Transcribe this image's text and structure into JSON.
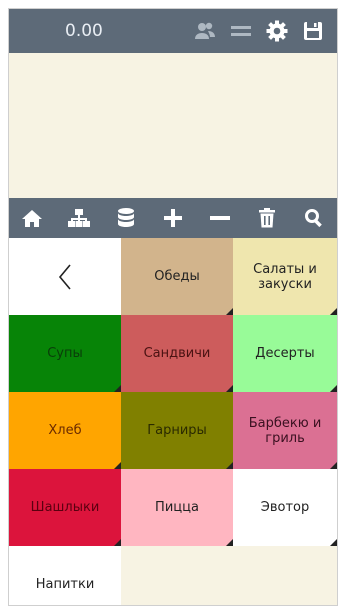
{
  "header": {
    "amount": "0.00",
    "icons": [
      "users-icon",
      "menu-lines-icon",
      "gear-icon",
      "save-icon"
    ]
  },
  "toolbar": {
    "buttons": [
      "home-icon",
      "hierarchy-icon",
      "database-icon",
      "plus-icon",
      "minus-icon",
      "trash-icon",
      "search-icon"
    ]
  },
  "back": {
    "icon": "chevron-left-icon"
  },
  "categories": [
    {
      "label": "Обеды",
      "color": "#d2b48c"
    },
    {
      "label": "Салаты и закуски",
      "color": "#efe6ae"
    },
    {
      "label": "Супы",
      "color": "#078407",
      "text_color": "#0a3d0a"
    },
    {
      "label": "Сандвичи",
      "color": "#cd5c5c",
      "text_color": "#4a1212"
    },
    {
      "label": "Десерты",
      "color": "#98fb98"
    },
    {
      "label": "Хлеб",
      "color": "#ffa500",
      "text_color": "#6b2b00"
    },
    {
      "label": "Гарниры",
      "color": "#808000",
      "text_color": "#2a2a00"
    },
    {
      "label": "Барбекю и гриль",
      "color": "#db7093",
      "text_color": "#3a1020"
    },
    {
      "label": "Шашлыки",
      "color": "#dc143c",
      "text_color": "#5a0010"
    },
    {
      "label": "Пицца",
      "color": "#ffb6c1"
    },
    {
      "label": "Эвотор",
      "color": "#ffffff"
    },
    {
      "label": "Напитки",
      "color": "#ffffff"
    }
  ]
}
